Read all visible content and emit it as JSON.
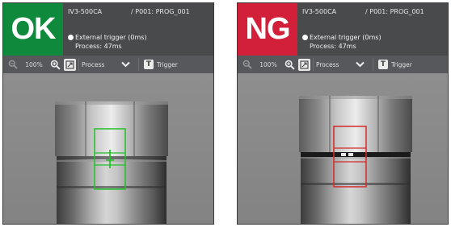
{
  "panels": [
    {
      "result": "OK",
      "result_color": "#0f8a3c",
      "model": "IV3-500CA",
      "program": "/ P001: PROG_001",
      "trigger": "External trigger (0ms)",
      "process": "Process: 47ms",
      "toolbar": {
        "zoom_out_icon": "zoom-out-icon",
        "zoom_level": "100%",
        "zoom_in_icon": "zoom-in-icon",
        "fit_icon": "fit-to-window-icon",
        "view_select": "Process",
        "chevron_icon": "chevron-down-icon",
        "trigger_label": "Trigger",
        "trigger_icon": "T"
      },
      "inspection_box_color": "#22c02a"
    },
    {
      "result": "NG",
      "result_color": "#d2203a",
      "model": "IV3-500CA",
      "program": "/ P001: PROG_001",
      "trigger": "External trigger (0ms)",
      "process": "Process: 47ms",
      "toolbar": {
        "zoom_out_icon": "zoom-out-icon",
        "zoom_level": "100%",
        "zoom_in_icon": "zoom-in-icon",
        "fit_icon": "fit-to-window-icon",
        "view_select": "Process",
        "chevron_icon": "chevron-down-icon",
        "trigger_label": "Trigger",
        "trigger_icon": "T"
      },
      "inspection_box_color": "#d42a2a"
    }
  ]
}
